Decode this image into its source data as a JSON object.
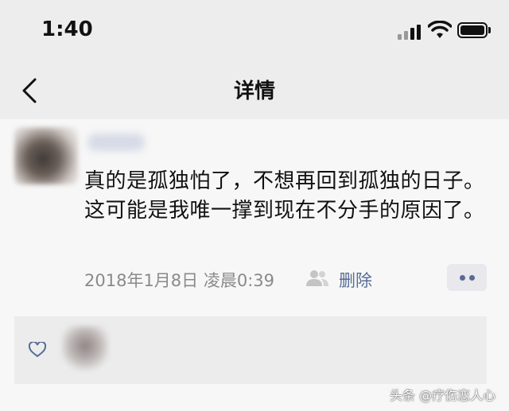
{
  "status_bar": {
    "time": "1:40"
  },
  "nav": {
    "title": "详情"
  },
  "post": {
    "text": "真的是孤独怕了，不想再回到孤独的日子。这可能是我唯一撑到现在不分手的原因了。",
    "timestamp": "2018年1月8日 凌晨0:39",
    "delete_label": "删除"
  },
  "watermark": "头条 @疗伤恋人心",
  "colors": {
    "link": "#576b95",
    "background": "#ededed",
    "card": "#f7f7f7"
  },
  "icons": [
    "back-arrow-icon",
    "signal-icon",
    "wifi-icon",
    "battery-icon",
    "friends-icon",
    "more-dots-icon",
    "heart-icon"
  ]
}
